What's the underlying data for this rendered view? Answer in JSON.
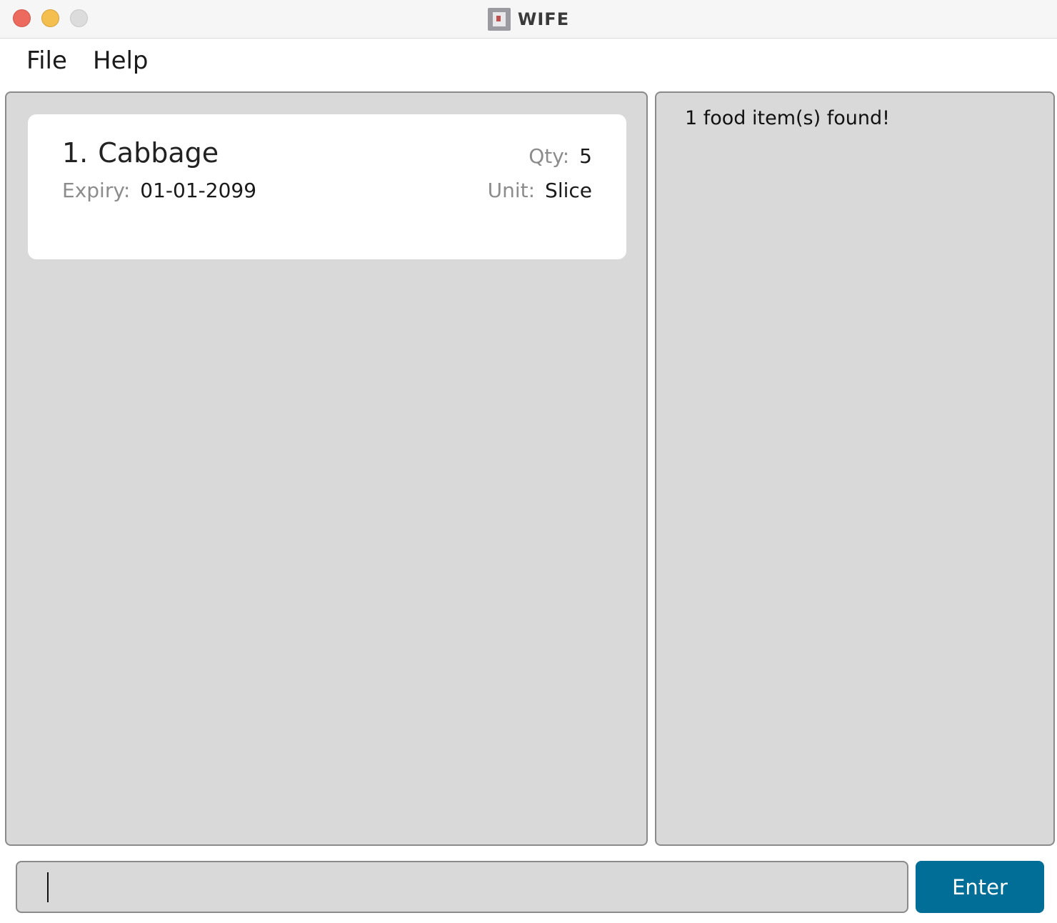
{
  "window": {
    "title": "WIFE",
    "icon": "app-icon"
  },
  "menu": {
    "file_label": "File",
    "help_label": "Help"
  },
  "food_list": [
    {
      "index": "1.",
      "name": "Cabbage",
      "expiry_label": "Expiry:",
      "expiry_value": "01-01-2099",
      "qty_label": "Qty:",
      "qty_value": "5",
      "unit_label": "Unit:",
      "unit_value": "Slice"
    }
  ],
  "result": {
    "message": "1 food item(s) found!"
  },
  "command": {
    "value": "",
    "enter_label": "Enter"
  },
  "colors": {
    "accent": "#006e96",
    "panel_bg": "#d9d9d9",
    "close": "#ec6a5e",
    "minimize": "#f4bf4f",
    "maximize": "#dcdcdc"
  }
}
